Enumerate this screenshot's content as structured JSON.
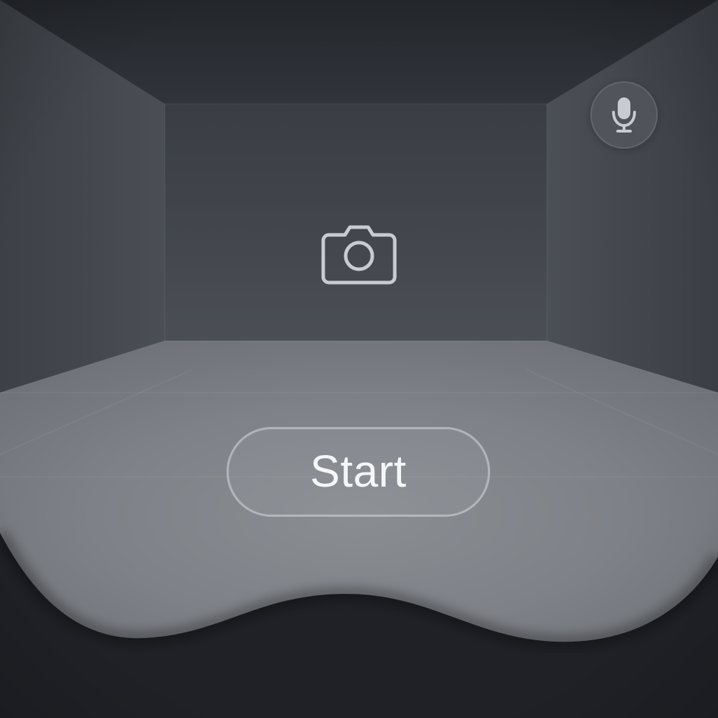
{
  "scene": {
    "background_color": "#1f2126",
    "wall_color": "#41454c",
    "floor_color": "#8a8d92"
  },
  "controls": {
    "microphone": {
      "icon": "microphone-icon"
    },
    "camera": {
      "icon": "camera-icon"
    },
    "start": {
      "label": "Start"
    }
  },
  "colors": {
    "icon_color": "#c8cbd1",
    "button_text": "#f5f6f7",
    "button_border": "#d4d8de"
  }
}
